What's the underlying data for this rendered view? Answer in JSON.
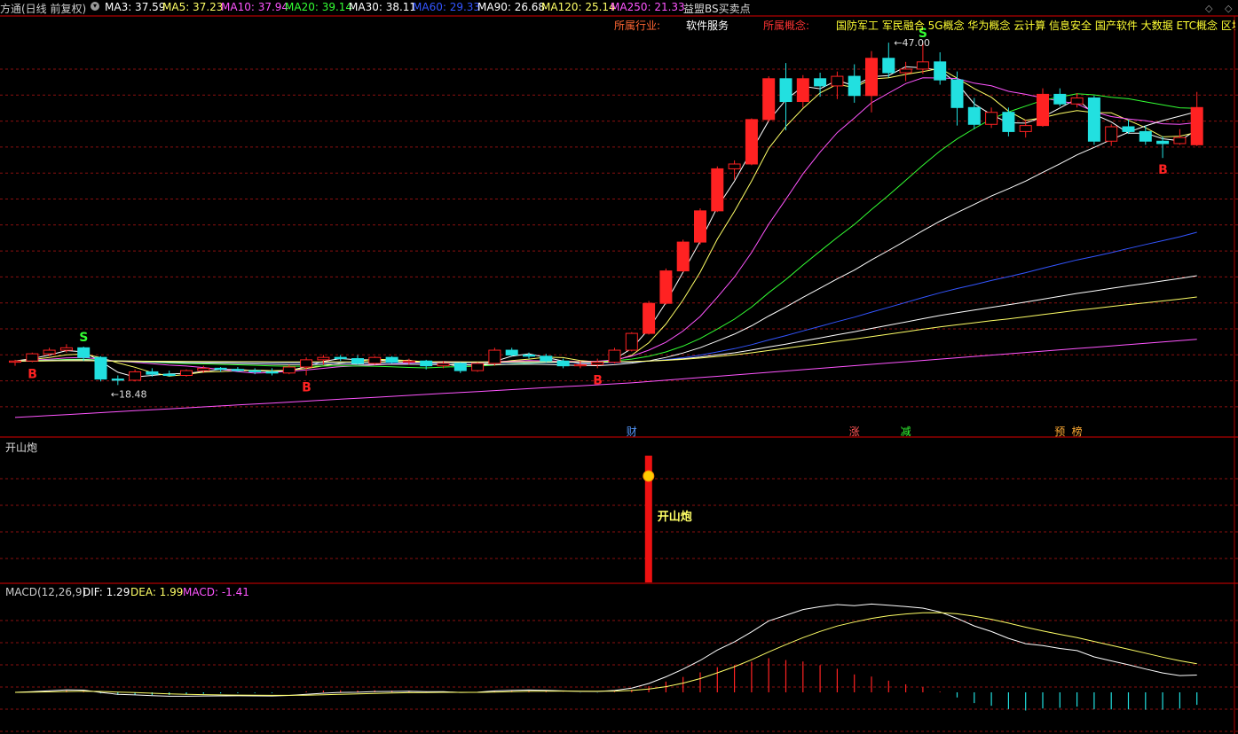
{
  "header": {
    "title_fragment": "方通(日线 前复权)",
    "ma_items": [
      {
        "label": "MA3: 37.59",
        "color": "#ffffff"
      },
      {
        "label": "MA5: 37.23",
        "color": "#ffff66"
      },
      {
        "label": "MA10: 37.94",
        "color": "#ff55ff"
      },
      {
        "label": "MA20: 39.14",
        "color": "#33ff33"
      },
      {
        "label": "MA30: 38.11",
        "color": "#ffffff"
      },
      {
        "label": "MA60: 29.33",
        "color": "#3355ff"
      },
      {
        "label": "MA90: 26.68",
        "color": "#ffffff"
      },
      {
        "label": "MA120: 25.14",
        "color": "#ffff66"
      },
      {
        "label": "MA250: 21.33",
        "color": "#ff55ff"
      }
    ],
    "indicator_name": "益盟BS买卖点"
  },
  "info_bar": {
    "industry_label": "所属行业:",
    "industry_value": "软件服务",
    "concept_label": "所属概念:",
    "concept_value": "国防军工 军民融合 5G概念 华为概念 云计算 信息安全 国产软件 大数据 ETC概念 区块"
  },
  "indicator_panel": {
    "title": "开山炮",
    "signal_label": "开山炮"
  },
  "macd_panel": {
    "name": "MACD(12,26,9)",
    "dif": "DIF: 1.29",
    "dea": "DEA: 1.99",
    "macd": "MACD: -1.41"
  },
  "event_markers": [
    "财",
    "涨",
    "减",
    "预",
    "榜"
  ],
  "colors": {
    "up": "#ff2222",
    "down": "#22e0e0",
    "grid": "#8a1010",
    "axis": "#b00000"
  },
  "chart_data": [
    {
      "type": "candlestick",
      "title": "益盟BS买卖点",
      "high_label": "47.00",
      "low_label": "18.48",
      "signals": [
        {
          "index": 1,
          "type": "B"
        },
        {
          "index": 4,
          "type": "S"
        },
        {
          "index": 17,
          "type": "B"
        },
        {
          "index": 34,
          "type": "B"
        },
        {
          "index": 53,
          "type": "S"
        },
        {
          "index": 67,
          "type": "B"
        }
      ],
      "bars": [
        [
          20.4,
          20.6,
          20.1,
          20.5
        ],
        [
          20.5,
          21.2,
          20.4,
          21.1
        ],
        [
          21.1,
          21.6,
          20.9,
          21.4
        ],
        [
          21.4,
          21.9,
          21.2,
          21.6
        ],
        [
          21.6,
          21.7,
          20.5,
          20.8
        ],
        [
          20.8,
          20.9,
          18.8,
          19.0
        ],
        [
          19.0,
          19.3,
          18.5,
          18.9
        ],
        [
          18.9,
          19.8,
          18.8,
          19.6
        ],
        [
          19.6,
          19.9,
          19.2,
          19.4
        ],
        [
          19.4,
          19.7,
          19.2,
          19.3
        ],
        [
          19.3,
          19.8,
          19.2,
          19.7
        ],
        [
          19.7,
          20.1,
          19.5,
          19.9
        ],
        [
          19.9,
          20.0,
          19.6,
          19.8
        ],
        [
          19.8,
          20.0,
          19.6,
          19.7
        ],
        [
          19.7,
          19.9,
          19.4,
          19.6
        ],
        [
          19.6,
          19.9,
          19.3,
          19.5
        ],
        [
          19.5,
          20.2,
          19.4,
          20.0
        ],
        [
          20.0,
          20.8,
          19.3,
          20.6
        ],
        [
          20.6,
          21.0,
          20.2,
          20.8
        ],
        [
          20.8,
          21.0,
          20.5,
          20.7
        ],
        [
          20.7,
          21.0,
          20.2,
          20.3
        ],
        [
          20.3,
          20.9,
          20.2,
          20.8
        ],
        [
          20.8,
          20.9,
          20.3,
          20.4
        ],
        [
          20.4,
          20.7,
          20.2,
          20.5
        ],
        [
          20.5,
          20.6,
          19.8,
          20.1
        ],
        [
          20.1,
          20.5,
          19.9,
          20.3
        ],
        [
          20.3,
          20.4,
          19.5,
          19.7
        ],
        [
          19.7,
          20.4,
          19.6,
          20.3
        ],
        [
          20.3,
          21.6,
          20.1,
          21.4
        ],
        [
          21.4,
          21.6,
          20.9,
          21.0
        ],
        [
          21.0,
          21.2,
          20.7,
          20.9
        ],
        [
          20.9,
          21.1,
          20.4,
          20.5
        ],
        [
          20.5,
          20.7,
          19.9,
          20.1
        ],
        [
          20.1,
          20.5,
          19.9,
          20.2
        ],
        [
          20.2,
          20.7,
          19.9,
          20.4
        ],
        [
          20.4,
          21.6,
          20.3,
          21.4
        ],
        [
          21.4,
          22.9,
          21.3,
          22.8
        ],
        [
          22.8,
          25.5,
          22.7,
          25.3
        ],
        [
          25.3,
          28.2,
          25.2,
          28.0
        ],
        [
          28.0,
          30.6,
          27.9,
          30.4
        ],
        [
          30.4,
          33.2,
          30.2,
          33.0
        ],
        [
          33.0,
          36.7,
          32.9,
          36.5
        ],
        [
          36.5,
          37.2,
          35.6,
          36.9
        ],
        [
          36.9,
          40.7,
          36.8,
          40.6
        ],
        [
          40.6,
          44.2,
          40.4,
          44.0
        ],
        [
          44.0,
          45.3,
          39.7,
          42.1
        ],
        [
          42.1,
          44.3,
          41.6,
          44.0
        ],
        [
          44.0,
          44.5,
          42.5,
          43.4
        ],
        [
          43.4,
          44.6,
          42.3,
          44.2
        ],
        [
          44.2,
          45.2,
          42.0,
          42.6
        ],
        [
          42.6,
          46.3,
          41.2,
          45.7
        ],
        [
          45.7,
          47.0,
          44.1,
          44.5
        ],
        [
          44.5,
          45.4,
          43.8,
          44.8
        ],
        [
          44.8,
          47.0,
          44.4,
          45.4
        ],
        [
          45.4,
          46.2,
          43.5,
          43.9
        ],
        [
          43.9,
          44.6,
          40.1,
          41.6
        ],
        [
          41.6,
          42.4,
          39.8,
          40.2
        ],
        [
          40.2,
          41.6,
          39.9,
          41.2
        ],
        [
          41.2,
          41.6,
          39.2,
          39.6
        ],
        [
          39.6,
          40.6,
          39.1,
          40.1
        ],
        [
          40.1,
          43.2,
          40.0,
          42.7
        ],
        [
          42.7,
          43.2,
          41.7,
          41.9
        ],
        [
          41.9,
          42.8,
          41.6,
          42.4
        ],
        [
          42.4,
          42.6,
          38.5,
          38.8
        ],
        [
          38.8,
          40.2,
          38.4,
          40.0
        ],
        [
          40.0,
          40.6,
          39.4,
          39.6
        ],
        [
          39.6,
          40.1,
          38.5,
          38.8
        ],
        [
          38.8,
          39.2,
          37.4,
          38.6
        ],
        [
          38.6,
          39.8,
          38.5,
          39.1
        ],
        [
          38.5,
          42.9,
          38.4,
          41.6
        ]
      ]
    },
    {
      "type": "bar",
      "title": "开山炮",
      "signal_index": 36
    },
    {
      "type": "macd",
      "title": "MACD(12,26,9)",
      "dif_last": 1.29,
      "dea_last": 1.99,
      "macd_last": -1.41
    }
  ]
}
